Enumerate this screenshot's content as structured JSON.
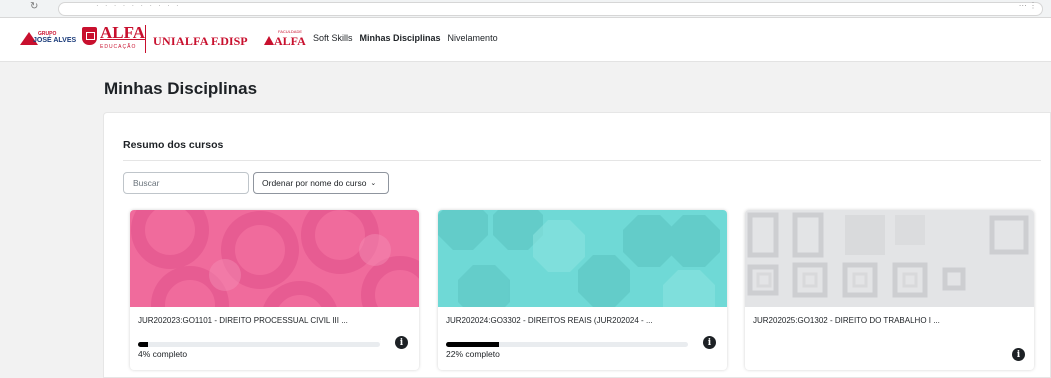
{
  "navbar": {
    "logos": {
      "grupo_small": "GRUPO",
      "grupo_name": "JOSÉ ALVES",
      "alfa": "ALFA",
      "alfa_sub": "EDUCAÇÃO",
      "unialfa": "UNIALFA",
      "fadisp": "F.DISP",
      "af_sup": "FACULDADE",
      "af": "ALFA"
    },
    "links": [
      {
        "label": "Soft Skills",
        "active": false
      },
      {
        "label": "Minhas Disciplinas",
        "active": true
      },
      {
        "label": "Nivelamento",
        "active": false
      }
    ]
  },
  "page": {
    "title": "Minhas Disciplinas"
  },
  "course_overview": {
    "title": "Resumo dos cursos",
    "search_placeholder": "Buscar",
    "sort_label": "Ordenar por nome do curso",
    "courses": [
      {
        "name": "JUR202023:GO1101 - DIREITO PROCESSUAL CIVIL III ...",
        "progress_percent": 4,
        "progress_label": "4% completo",
        "pattern_color": "#f06b9c"
      },
      {
        "name": "JUR202024:GO3302 - DIREITOS REAIS (JUR202024 - ...",
        "progress_percent": 22,
        "progress_label": "22% completo",
        "pattern_color": "#6fd9d6"
      },
      {
        "name": "JUR202025:GO1302 - DIREITO DO TRABALHO I ...",
        "progress_percent": null,
        "progress_label": "",
        "pattern_color": "#e3e4e6"
      }
    ]
  }
}
